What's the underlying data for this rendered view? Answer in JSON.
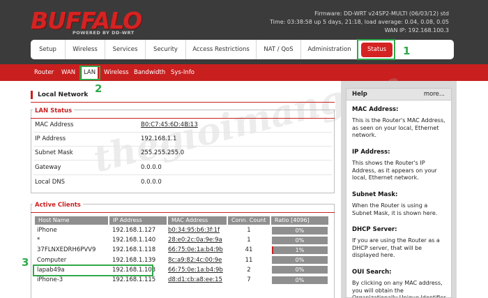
{
  "header": {
    "logo_text": "BUFFALO",
    "logo_subtext": "POWERED BY DD-WRT",
    "firmware": "Firmware: DD-WRT v24SP2-MULTI (06/03/12) std",
    "time": "Time: 03:38:58 up 5 days, 21:18, load average: 0.04, 0.08, 0.05",
    "wan_ip": "WAN IP: 192.168.100.3"
  },
  "topnav": {
    "tabs": [
      {
        "label": "Setup"
      },
      {
        "label": "Wireless"
      },
      {
        "label": "Services"
      },
      {
        "label": "Security"
      },
      {
        "label": "Access Restrictions"
      },
      {
        "label": "NAT / QoS"
      },
      {
        "label": "Administration"
      },
      {
        "label": "Status"
      }
    ]
  },
  "subnav": {
    "items": [
      {
        "label": "Router"
      },
      {
        "label": "WAN"
      },
      {
        "label": "LAN"
      },
      {
        "label": "Wireless"
      },
      {
        "label": "Bandwidth"
      },
      {
        "label": "Sys-Info"
      }
    ]
  },
  "annotations": {
    "n1": "1",
    "n2": "2",
    "n3": "3"
  },
  "main": {
    "title": "Local Network",
    "lan_status": {
      "legend": "LAN Status",
      "rows": [
        {
          "label": "MAC Address",
          "value": "B0:C7:45:6D:4B:13"
        },
        {
          "label": "IP Address",
          "value": "192.168.1.1"
        },
        {
          "label": "Subnet Mask",
          "value": "255.255.255.0"
        },
        {
          "label": "Gateway",
          "value": "0.0.0.0"
        },
        {
          "label": "Local DNS",
          "value": "0.0.0.0"
        }
      ]
    },
    "active_clients": {
      "legend": "Active Clients",
      "headers": [
        "Host Name",
        "IP Address",
        "MAC Address",
        "Conn. Count",
        "Ratio [4096]"
      ],
      "rows": [
        {
          "host": "iPhone",
          "ip": "192.168.1.127",
          "mac": "b0:34:95:b6:3f:1f",
          "count": "1",
          "ratio": "0%",
          "ratio_value": 0
        },
        {
          "host": "*",
          "ip": "192.168.1.140",
          "mac": "28:e0:2c:0a:9e:9a",
          "count": "1",
          "ratio": "0%",
          "ratio_value": 0
        },
        {
          "host": "37FLNXEDRH6PVV9",
          "ip": "192.168.1.118",
          "mac": "66:75:0e:1a:b4:9b",
          "count": "41",
          "ratio": "1%",
          "ratio_value": 1
        },
        {
          "host": "Computer",
          "ip": "192.168.1.139",
          "mac": "8c:a9:82:4c:00:9e",
          "count": "11",
          "ratio": "0%",
          "ratio_value": 0
        },
        {
          "host": "lapab49a",
          "ip": "192.168.1.103",
          "mac": "66:75:0e:1a:b4:9b",
          "count": "2",
          "ratio": "0%",
          "ratio_value": 0
        },
        {
          "host": "iPhone-3",
          "ip": "192.168.1.115",
          "mac": "d8:d1:cb:a8:ee:15",
          "count": "7",
          "ratio": "0%",
          "ratio_value": 0
        }
      ]
    }
  },
  "help": {
    "title": "Help",
    "more": "more...",
    "items": [
      {
        "title": "MAC Address:",
        "text": "This is the Router's MAC Address, as seen on your local, Ethernet network."
      },
      {
        "title": "IP Address:",
        "text": "This shows the Router's IP Address, as it appears on your local, Ethernet network."
      },
      {
        "title": "Subnet Mask:",
        "text": "When the Router is using a Subnet Mask, it is shown here."
      },
      {
        "title": "DHCP Server:",
        "text": "If you are using the Router as a DHCP server, that will be displayed here."
      },
      {
        "title": "OUI Search:",
        "text": "By clicking on any MAC address, you will obtain the Organizationally Unique Identifier of the network"
      }
    ]
  },
  "watermark": "thegioimang.vn",
  "colors": {
    "brand_red": "#c91f1f",
    "highlight_green": "#2fa84a",
    "header_bg": "#3b3b3b"
  }
}
